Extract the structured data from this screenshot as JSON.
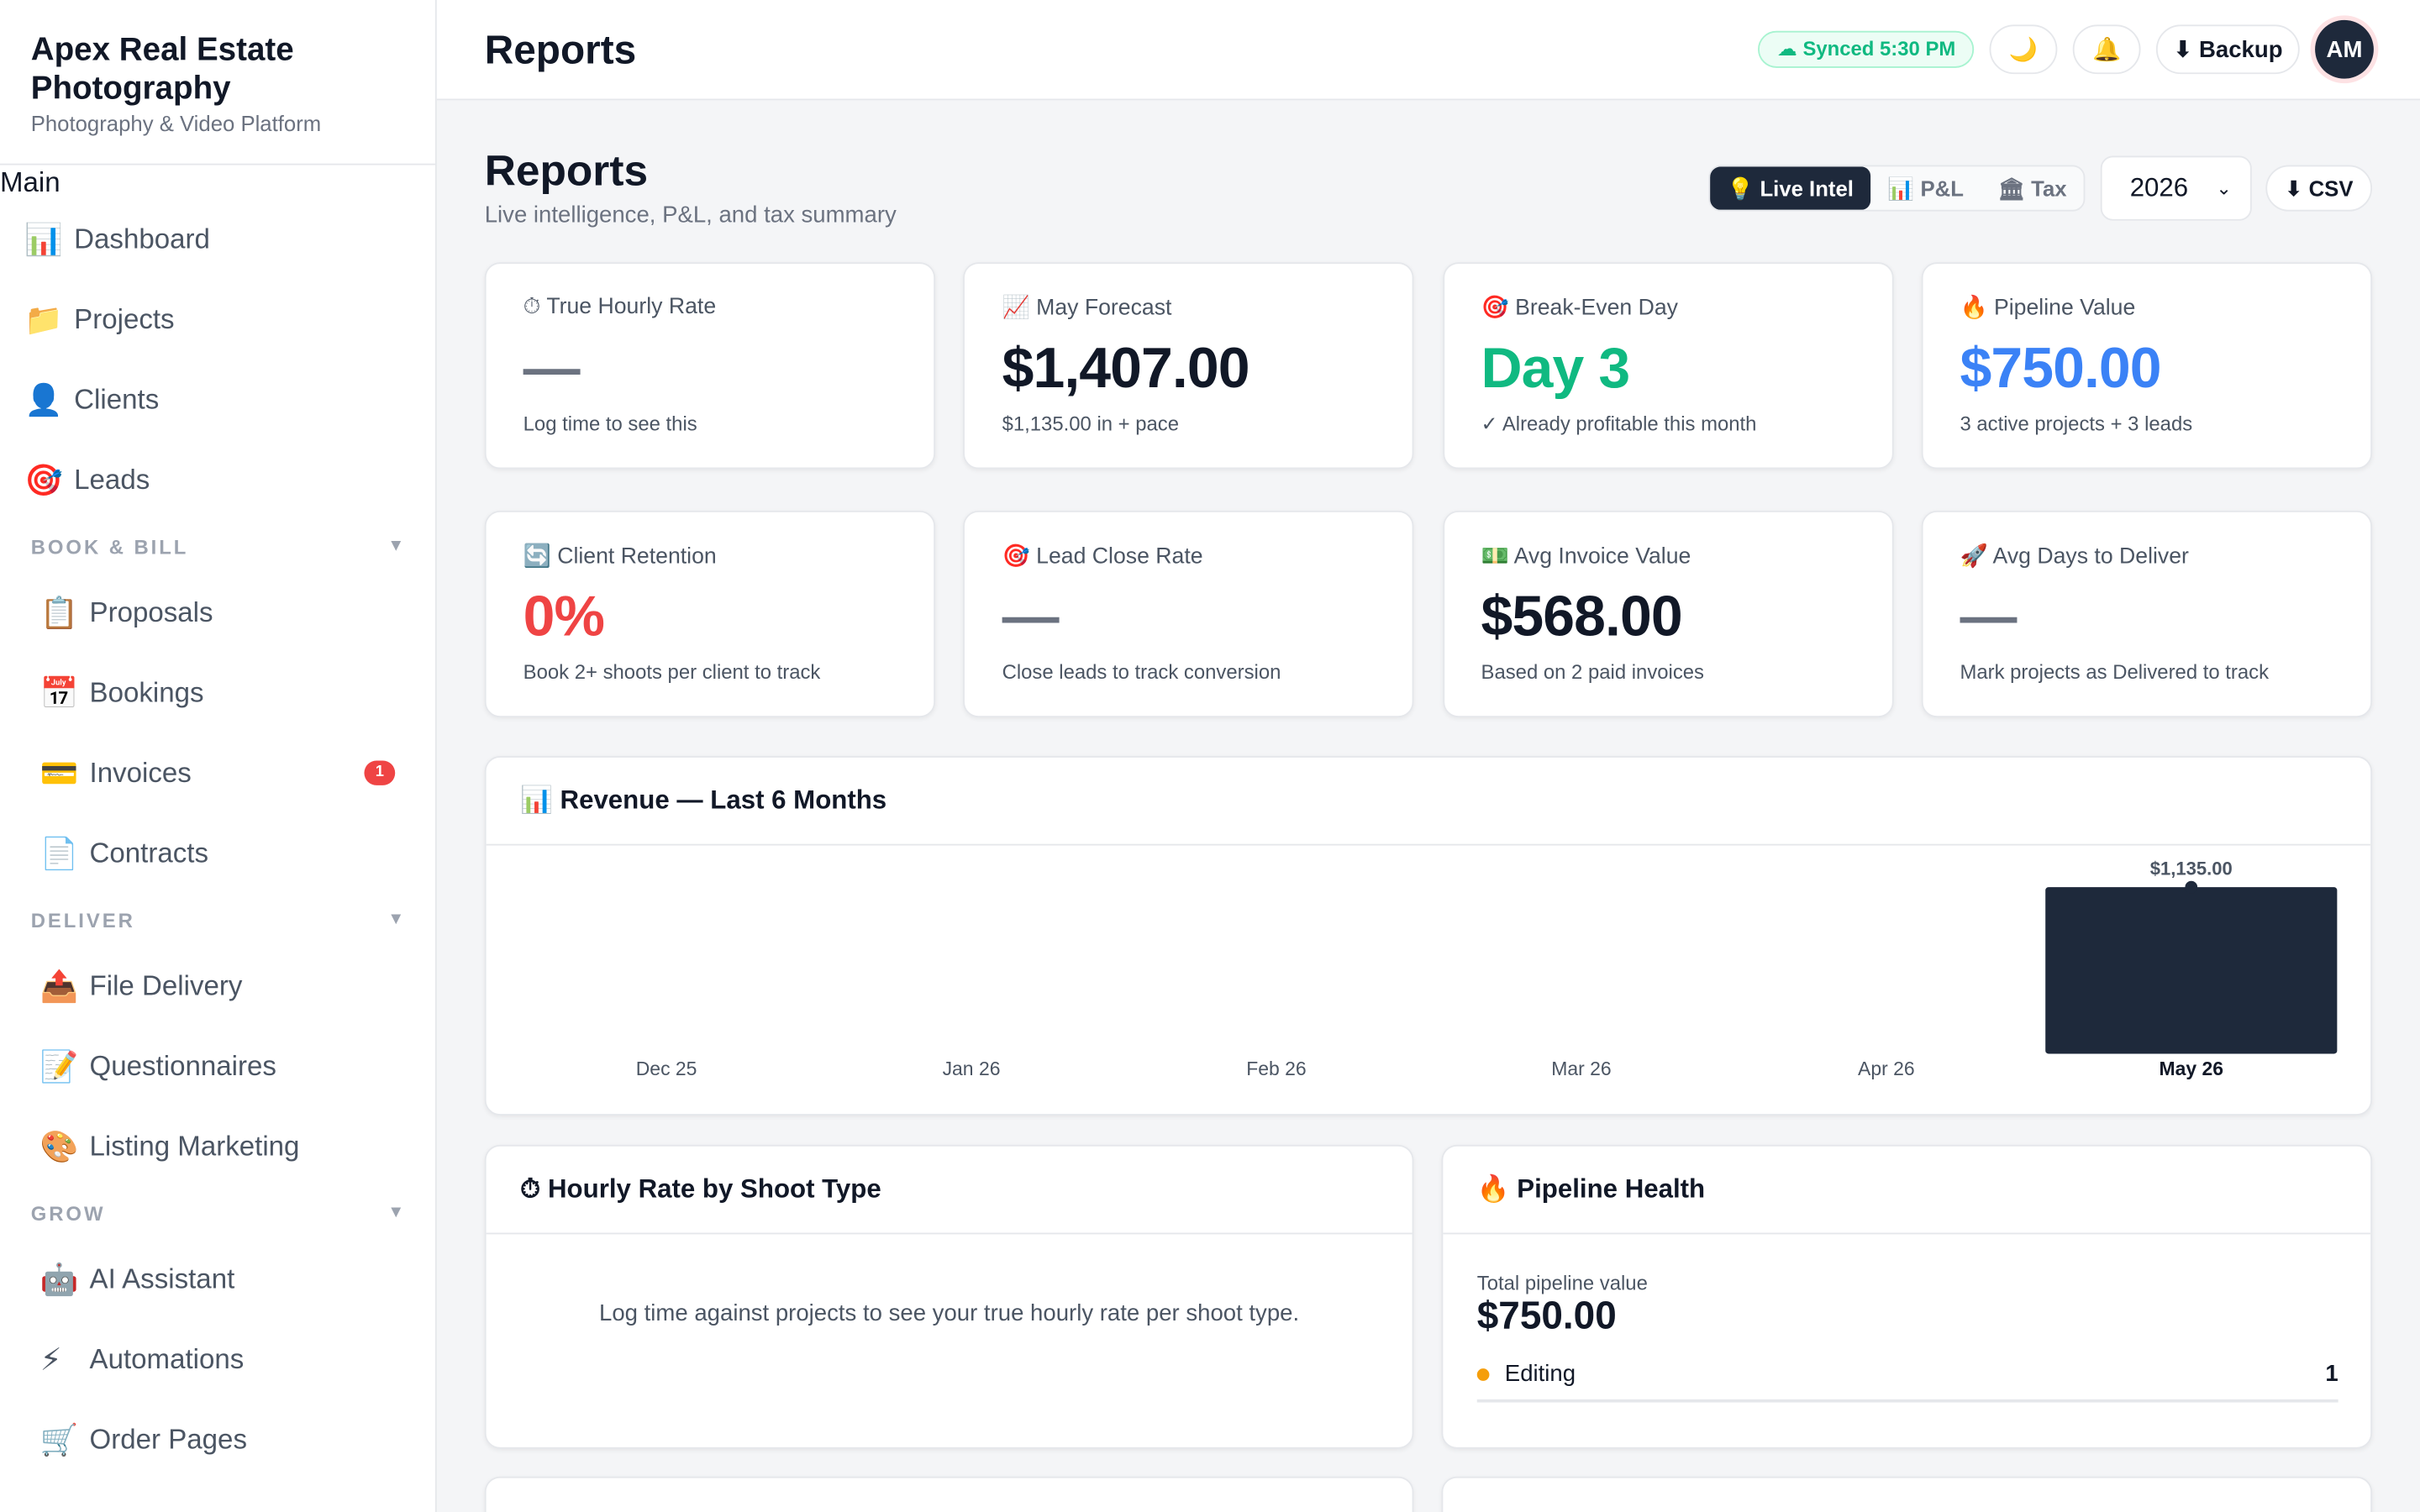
{
  "brand": {
    "name": "Apex Real Estate Photography",
    "subtitle": "Photography & Video Platform"
  },
  "nav": {
    "main_heading": "Main",
    "main_items": [
      {
        "icon": "📊",
        "label": "Dashboard"
      },
      {
        "icon": "📁",
        "label": "Projects"
      },
      {
        "icon": "👤",
        "label": "Clients"
      },
      {
        "icon": "🎯",
        "label": "Leads"
      }
    ],
    "book_bill": {
      "heading": "BOOK & BILL",
      "items": [
        {
          "icon": "📋",
          "label": "Proposals"
        },
        {
          "icon": "📅",
          "label": "Bookings"
        },
        {
          "icon": "💳",
          "label": "Invoices",
          "badge": "1"
        },
        {
          "icon": "📄",
          "label": "Contracts"
        }
      ]
    },
    "deliver": {
      "heading": "DELIVER",
      "items": [
        {
          "icon": "📤",
          "label": "File Delivery"
        },
        {
          "icon": "📝",
          "label": "Questionnaires"
        },
        {
          "icon": "🎨",
          "label": "Listing Marketing"
        }
      ]
    },
    "grow": {
      "heading": "GROW",
      "items": [
        {
          "icon": "🤖",
          "label": "AI Assistant"
        },
        {
          "icon": "⚡",
          "label": "Automations"
        },
        {
          "icon": "🛒",
          "label": "Order Pages"
        }
      ]
    }
  },
  "topbar": {
    "title": "Reports",
    "sync": "☁ Synced 5:30 PM",
    "theme_icon": "🌙",
    "bell_icon": "🔔",
    "backup": "⬇ Backup",
    "avatar": "AM"
  },
  "page": {
    "title": "Reports",
    "subtitle": "Live intelligence, P&L, and tax summary",
    "tabs": [
      "💡 Live Intel",
      "📊 P&L",
      "🏛 Tax"
    ],
    "year": "2026",
    "csv": "⬇ CSV"
  },
  "kpis": [
    {
      "label": "⏱ True Hourly Rate",
      "value": "—",
      "note": "Log time to see this",
      "color": "dash"
    },
    {
      "label": "📈 May Forecast",
      "value": "$1,407.00",
      "note": "$1,135.00 in + pace",
      "color": ""
    },
    {
      "label": "🎯 Break-Even Day",
      "value": "Day 3",
      "note": "✓ Already profitable this month",
      "color": "green"
    },
    {
      "label": "🔥 Pipeline Value",
      "value": "$750.00",
      "note": "3 active projects + 3 leads",
      "color": "blue"
    },
    {
      "label": "🔄 Client Retention",
      "value": "0%",
      "note": "Book 2+ shoots per client to track",
      "color": "red"
    },
    {
      "label": "🎯 Lead Close Rate",
      "value": "—",
      "note": "Close leads to track conversion",
      "color": "dash"
    },
    {
      "label": "💵 Avg Invoice Value",
      "value": "$568.00",
      "note": "Based on 2 paid invoices",
      "color": ""
    },
    {
      "label": "🚀 Avg Days to Deliver",
      "value": "—",
      "note": "Mark projects as Delivered to track",
      "color": "dash"
    }
  ],
  "revenue": {
    "title": "📊 Revenue — Last 6 Months",
    "bar_color": "#1e293b"
  },
  "chart_data": {
    "type": "bar",
    "title": "📊 Revenue — Last 6 Months",
    "categories": [
      "Dec 25",
      "Jan 26",
      "Feb 26",
      "Mar 26",
      "Apr 26",
      "May 26"
    ],
    "values": [
      0,
      0,
      0,
      0,
      0,
      1135
    ],
    "data_labels": [
      "",
      "",
      "",
      "",
      "",
      "$1,135.00"
    ],
    "highlight": "May 26",
    "ylim": [
      0,
      1135
    ],
    "grid": false
  },
  "hourly": {
    "title": "⏱ Hourly Rate by Shoot Type",
    "message": "Log time against projects to see your true hourly rate per shoot type."
  },
  "pipeline": {
    "title": "🔥 Pipeline Health",
    "total_label": "Total pipeline value",
    "total": "$750.00",
    "rows": [
      {
        "label": "Editing",
        "count": "1"
      }
    ]
  }
}
